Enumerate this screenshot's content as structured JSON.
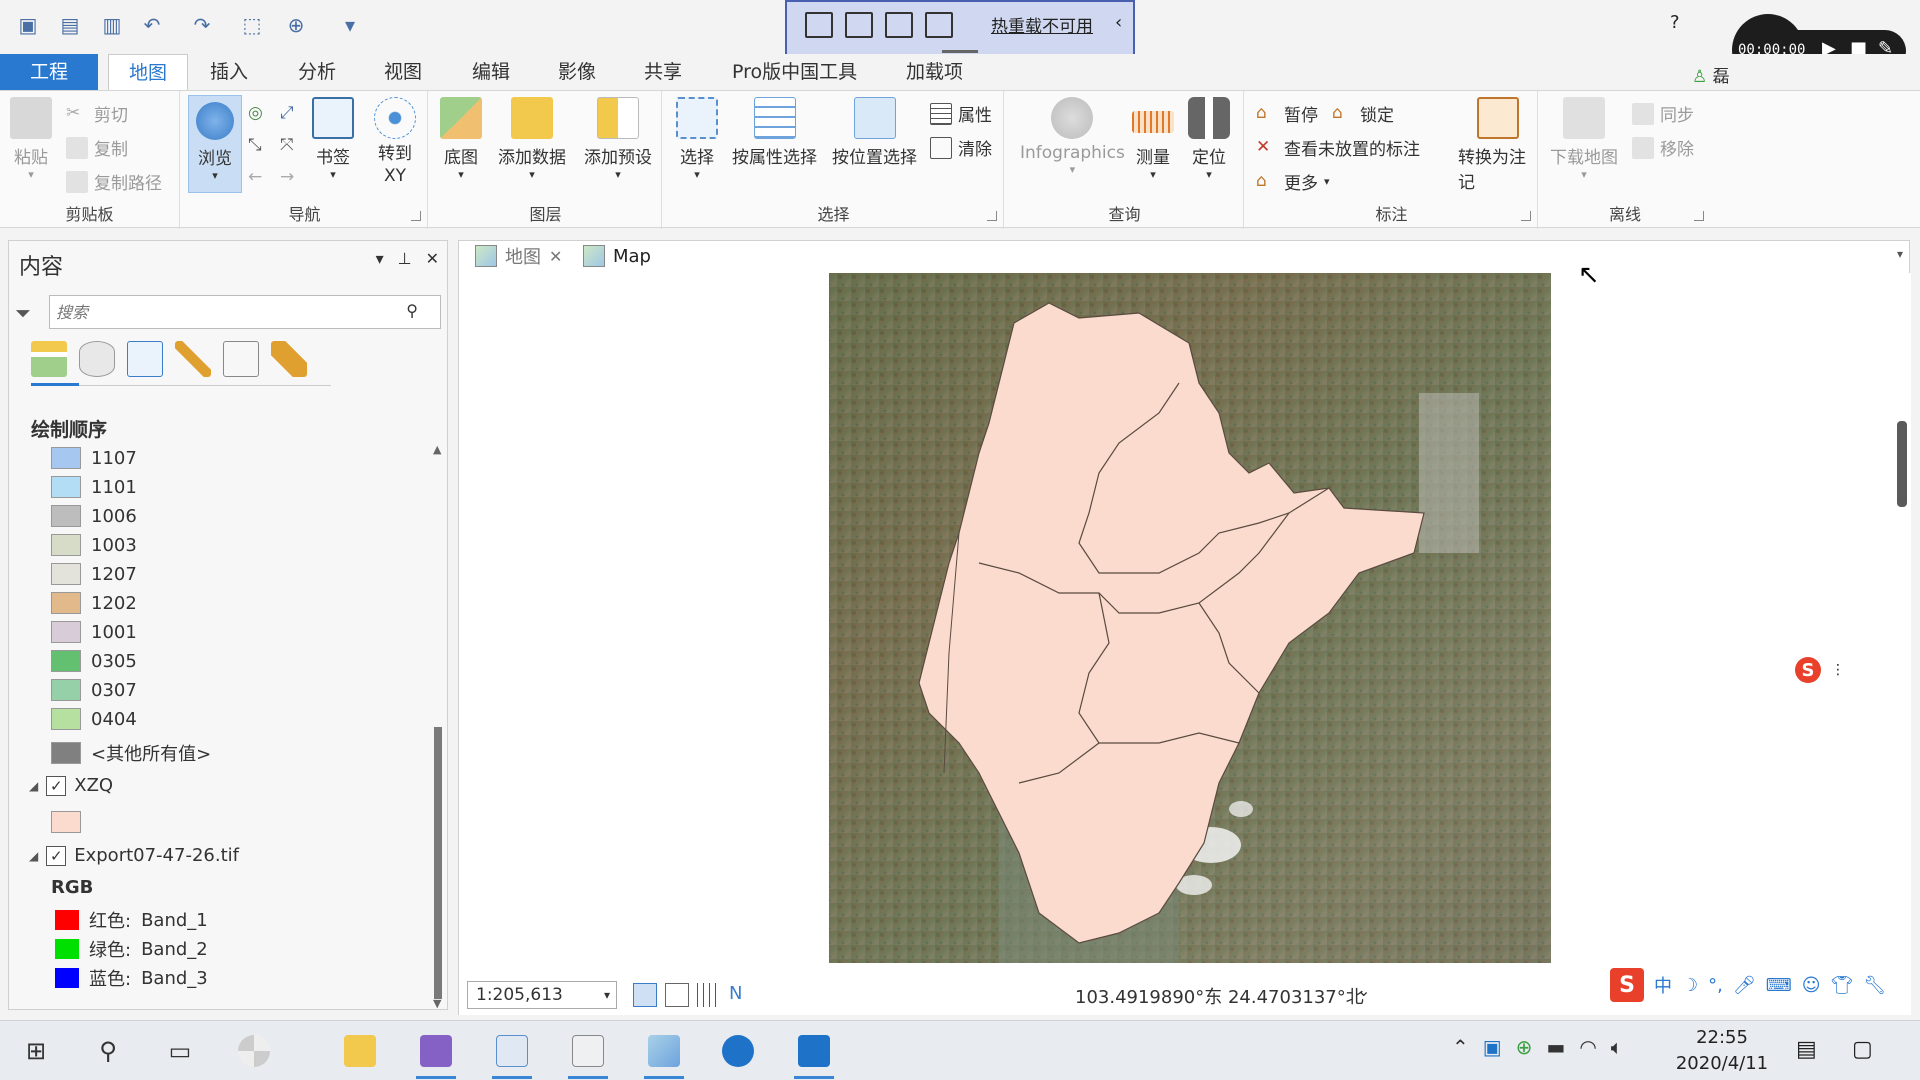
{
  "hot_reload": {
    "label": "热重载不可用"
  },
  "recorder": {
    "time": "00:00:00"
  },
  "window": {
    "help": "?",
    "user": "磊"
  },
  "tabs": [
    {
      "label": "工程"
    },
    {
      "label": "地图"
    },
    {
      "label": "插入"
    },
    {
      "label": "分析"
    },
    {
      "label": "视图"
    },
    {
      "label": "编辑"
    },
    {
      "label": "影像"
    },
    {
      "label": "共享"
    },
    {
      "label": "Pro版中国工具"
    },
    {
      "label": "加载项"
    }
  ],
  "ribbon": {
    "clipboard": {
      "label": "剪贴板",
      "paste": "粘贴",
      "cut": "剪切",
      "copy": "复制",
      "copy_path": "复制路径"
    },
    "navigate": {
      "label": "导航",
      "explore": "浏览",
      "bookmarks": "书签",
      "goto_xy": "转到\nXY"
    },
    "layer": {
      "label": "图层",
      "basemap": "底图",
      "add_data": "添加数据",
      "add_preset": "添加预设"
    },
    "selection": {
      "label": "选择",
      "select": "选择",
      "select_by_attr": "按属性选择",
      "select_by_loc": "按位置选择",
      "attributes": "属性",
      "clear": "清除"
    },
    "inquiry": {
      "label": "查询",
      "infographics": "Infographics",
      "measure": "测量",
      "locate": "定位"
    },
    "labeling": {
      "label": "标注",
      "pause": "暂停",
      "lock": "锁定",
      "view_unplaced": "查看未放置的标注",
      "more": "更多",
      "convert": "转换为注记"
    },
    "offline": {
      "label": "离线",
      "download": "下载地图",
      "sync": "同步",
      "remove": "移除"
    }
  },
  "contents": {
    "title": "内容",
    "search_placeholder": "搜索",
    "draw_order": "绘制顺序",
    "legend": [
      {
        "label": "1107",
        "color": "#a6c8f0"
      },
      {
        "label": "1101",
        "color": "#b3dcf5"
      },
      {
        "label": "1006",
        "color": "#bdbdbd"
      },
      {
        "label": "1003",
        "color": "#d6dcc8"
      },
      {
        "label": "1207",
        "color": "#e3e3dc"
      },
      {
        "label": "1202",
        "color": "#e2b98a"
      },
      {
        "label": "1001",
        "color": "#d9ccd9"
      },
      {
        "label": "0305",
        "color": "#62c070"
      },
      {
        "label": "0307",
        "color": "#96d0a8"
      },
      {
        "label": "0404",
        "color": "#b6e0a0"
      },
      {
        "label": "<其他所有值>",
        "color": "#808080"
      }
    ],
    "layers": [
      {
        "name": "XZQ",
        "checked": true,
        "swatch": "#fadbcd"
      },
      {
        "name": "Export07-47-26.tif",
        "checked": true
      }
    ],
    "rgb": {
      "title": "RGB",
      "bands": [
        {
          "channel": "红色:",
          "band": "Band_1",
          "color": "#ff0000"
        },
        {
          "channel": "绿色:",
          "band": "Band_2",
          "color": "#00e000"
        },
        {
          "channel": "蓝色:",
          "band": "Band_3",
          "color": "#0000ff"
        }
      ]
    }
  },
  "map_tabs": [
    {
      "label": "地图",
      "active": false
    },
    {
      "label": "Map",
      "active": true
    }
  ],
  "status": {
    "scale": "1:205,613",
    "coords": "103.4919890°东 24.4703137°北"
  },
  "taskbar": {
    "time": "22:55",
    "date": "2020/4/11",
    "ime": "中"
  },
  "colors": {
    "accent": "#2a79d1",
    "district_fill": "#fadbcd",
    "district_border": "#5a4a40"
  }
}
